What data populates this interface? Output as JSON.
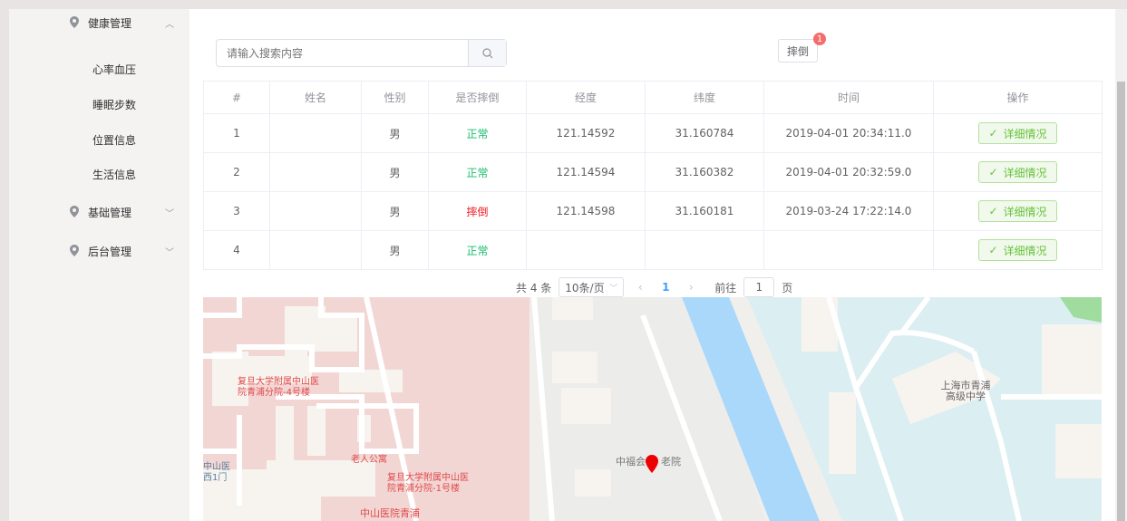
{
  "sidebar": {
    "groups": [
      {
        "label": "健康管理",
        "expanded": true,
        "items": [
          "心率血压",
          "睡眠步数",
          "位置信息",
          "生活信息"
        ]
      },
      {
        "label": "基础管理",
        "expanded": false
      },
      {
        "label": "后台管理",
        "expanded": false
      }
    ]
  },
  "search": {
    "placeholder": "请输入搜索内容",
    "value": ""
  },
  "fall_button": {
    "label": "摔倒",
    "badge": "1"
  },
  "table": {
    "headers": [
      "#",
      "姓名",
      "性别",
      "是否摔倒",
      "经度",
      "纬度",
      "时间",
      "操作"
    ],
    "rows": [
      {
        "index": "1",
        "name": "",
        "gender": "男",
        "status": "正常",
        "status_type": "ok",
        "lng": "121.14592",
        "lat": "31.160784",
        "time": "2019-04-01 20:34:11.0",
        "action": "详细情况"
      },
      {
        "index": "2",
        "name": "",
        "gender": "男",
        "status": "正常",
        "status_type": "ok",
        "lng": "121.14594",
        "lat": "31.160382",
        "time": "2019-04-01 20:32:59.0",
        "action": "详细情况"
      },
      {
        "index": "3",
        "name": "",
        "gender": "男",
        "status": "摔倒",
        "status_type": "bad",
        "lng": "121.14598",
        "lat": "31.160181",
        "time": "2019-03-24 17:22:14.0",
        "action": "详细情况"
      },
      {
        "index": "4",
        "name": "",
        "gender": "男",
        "status": "正常",
        "status_type": "ok",
        "lng": "",
        "lat": "",
        "time": "",
        "action": "详细情况"
      }
    ]
  },
  "pagination": {
    "total": "共 4 条",
    "page_size": "10条/页",
    "current": "1",
    "goto_prefix": "前往",
    "goto_value": "1",
    "goto_suffix": "页"
  },
  "map": {
    "labels": [
      "复旦大学附属中山医院青浦分院-4号楼",
      "老人公寓",
      "复旦大学附属中山医院青浦分院-1号楼",
      "中山医院青浦",
      "中山医西1门",
      "中福会",
      "老院",
      "上海市青浦高级中学"
    ]
  }
}
